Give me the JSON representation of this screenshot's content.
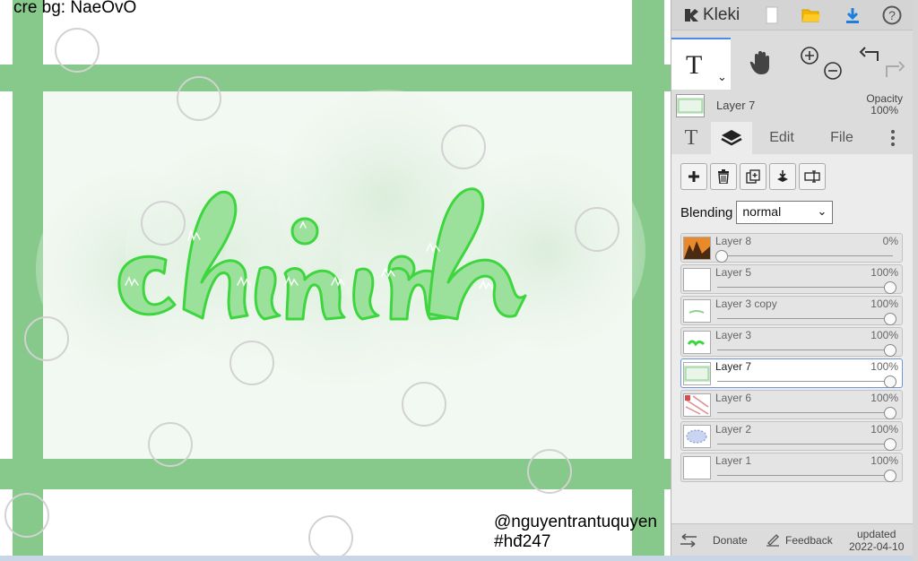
{
  "canvas": {
    "credit": "cre bg: NaeOvO",
    "artwork_text": "chinh",
    "watermark_handle": "@nguyentrantuquyen",
    "watermark_tag": "#hđ247",
    "colors": {
      "frame": "#86c98a",
      "letters": "#9be09b",
      "letter_outline": "#3ed63e",
      "wash": "#e7f3e7"
    }
  },
  "sidebar": {
    "app_name": "Kleki",
    "top_icons": [
      "new-image-icon",
      "open-folder-icon",
      "download-icon",
      "help-icon"
    ],
    "tools": {
      "text_tool": "T",
      "hand_tool": "hand-icon",
      "zoom": [
        "zoom-in-icon",
        "zoom-out-icon"
      ],
      "history": [
        "undo-icon",
        "redo-icon"
      ]
    },
    "active_layer": {
      "name": "Layer 7",
      "opacity_label": "Opacity",
      "opacity_value": "100%"
    },
    "tabs": [
      {
        "label": "T",
        "icon": "text-tool-icon"
      },
      {
        "label": "",
        "icon": "layers-icon"
      },
      {
        "label": "Edit"
      },
      {
        "label": "File"
      }
    ],
    "layer_actions": [
      "add-layer-icon",
      "delete-layer-icon",
      "duplicate-layer-icon",
      "merge-down-icon",
      "rename-layer-icon"
    ],
    "blending": {
      "label": "Blending",
      "value": "normal"
    },
    "layers": [
      {
        "name": "Layer 8",
        "opacity": "0%",
        "opacity_value": 0
      },
      {
        "name": "Layer 5",
        "opacity": "100%",
        "opacity_value": 100
      },
      {
        "name": "Layer 3 copy",
        "opacity": "100%",
        "opacity_value": 100
      },
      {
        "name": "Layer 3",
        "opacity": "100%",
        "opacity_value": 100
      },
      {
        "name": "Layer 7",
        "opacity": "100%",
        "opacity_value": 100,
        "selected": true
      },
      {
        "name": "Layer 6",
        "opacity": "100%",
        "opacity_value": 100
      },
      {
        "name": "Layer 2",
        "opacity": "100%",
        "opacity_value": 100
      },
      {
        "name": "Layer 1",
        "opacity": "100%",
        "opacity_value": 100
      }
    ],
    "footer": {
      "donate": "Donate",
      "feedback": "Feedback",
      "updated_line1": "updated",
      "updated_line2": "2022-04-10"
    }
  }
}
